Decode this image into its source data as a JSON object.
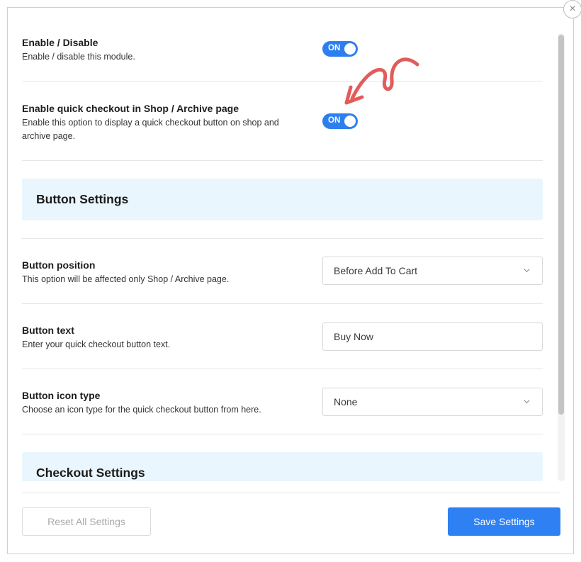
{
  "close_icon": "×",
  "settings": {
    "enable": {
      "title": "Enable / Disable",
      "description": "Enable / disable this module.",
      "toggle_label": "ON"
    },
    "quick_checkout": {
      "title": "Enable quick checkout in Shop / Archive page",
      "description": "Enable this option to display a quick checkout button on shop and archive page.",
      "toggle_label": "ON"
    }
  },
  "button_settings": {
    "heading": "Button Settings",
    "position": {
      "title": "Button position",
      "description": "This option will be affected only Shop / Archive page.",
      "value": "Before Add To Cart"
    },
    "text": {
      "title": "Button text",
      "description": "Enter your quick checkout button text.",
      "value": "Buy Now"
    },
    "icon_type": {
      "title": "Button icon type",
      "description": "Choose an icon type for the quick checkout button from here.",
      "value": "None"
    }
  },
  "checkout_settings": {
    "heading": "Checkout Settings"
  },
  "footer": {
    "reset_label": "Reset All Settings",
    "save_label": "Save Settings"
  },
  "colors": {
    "accent": "#2f80f2",
    "toggle_on": "#2d7ff0",
    "section_bg": "#eaf6fd",
    "annotation_arrow": "#e25c5c"
  },
  "icons": {
    "close": "close-icon",
    "chevron": "chevron-down-icon",
    "annotation": "arrow-annotation-icon"
  }
}
